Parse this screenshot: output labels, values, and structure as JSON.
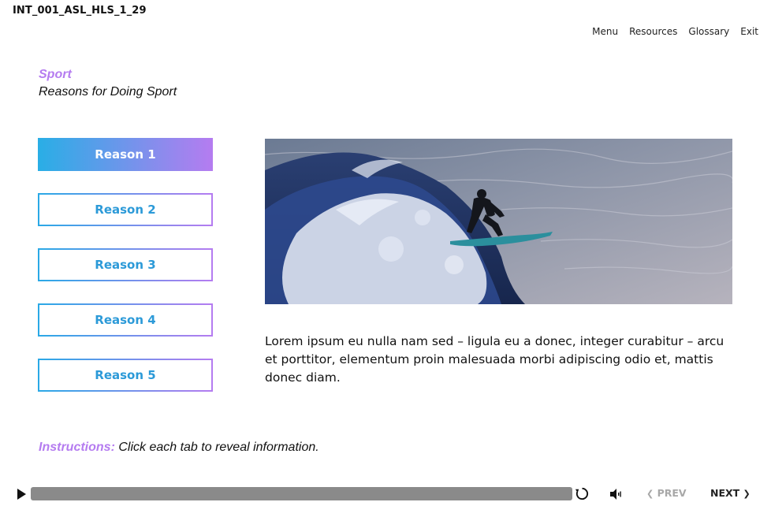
{
  "header": {
    "course_id": "INT_001_ASL_HLS_1_29",
    "nav": [
      "Menu",
      "Resources",
      "Glossary",
      "Exit"
    ]
  },
  "content": {
    "section_title": "Sport",
    "page_title": "Reasons for Doing Sport",
    "tabs": [
      {
        "label": "Reason 1",
        "active": true
      },
      {
        "label": "Reason 2",
        "active": false
      },
      {
        "label": "Reason 3",
        "active": false
      },
      {
        "label": "Reason 4",
        "active": false
      },
      {
        "label": "Reason 5",
        "active": false
      }
    ],
    "image_icon": "surfer-photo",
    "body_text": "Lorem ipsum eu nulla nam sed – ligula eu a donec, integer curabitur – arcu et porttitor, elementum proin malesuada morbi adipiscing odio et, mattis donec diam.",
    "instructions_label": "Instructions:",
    "instructions_text": " Click each tab to reveal information."
  },
  "player": {
    "play_icon": "play-icon",
    "replay_icon": "replay-icon",
    "volume_icon": "volume-icon",
    "prev_label": "PREV",
    "next_label": "NEXT",
    "prev_enabled": false
  },
  "colors": {
    "accent_purple": "#b57cf0",
    "accent_blue": "#2aa9e6",
    "progress_track": "#8a8a8a"
  }
}
